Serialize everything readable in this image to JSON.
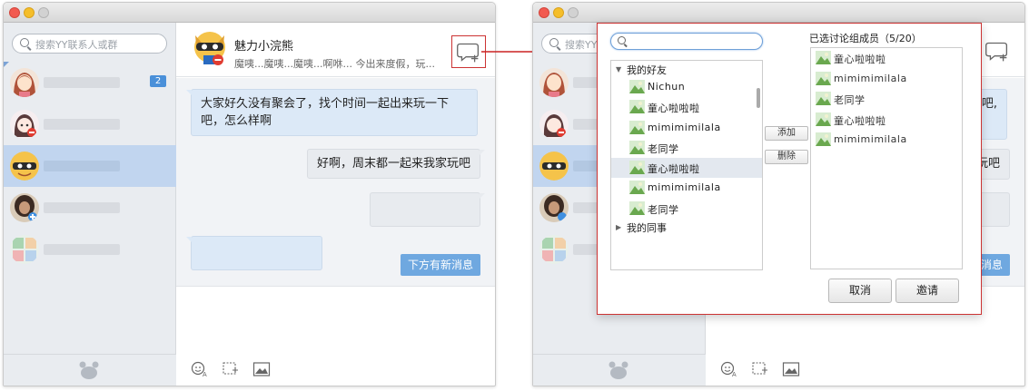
{
  "left_window": {
    "search_placeholder": "搜索YY联系人或群",
    "contacts": [
      {
        "badge": "2"
      },
      {},
      {},
      {},
      {}
    ],
    "chat": {
      "name": "魅力小浣熊",
      "signature": "魔咦...魔咦...魔咦...啊咻... 今出来度假，玩...",
      "messages": [
        {
          "side": "left",
          "text": "大家好久没有聚会了，找个时间一起出来玩一下吧，怎么样啊"
        },
        {
          "side": "right",
          "text": "好啊，周末都一起来我家玩吧"
        }
      ],
      "new_message_label": "下方有新消息"
    }
  },
  "right_window": {
    "search_placeholder": "搜索YY",
    "partial_texts": [
      "吧,",
      "玩吧",
      "新消息"
    ]
  },
  "dialog": {
    "search_value": "",
    "groups": [
      {
        "label": "我的好友",
        "expanded": true,
        "friends": [
          "Nichun",
          "童心啦啦啦",
          "mimimimilala",
          "老同学",
          "童心啦啦啦",
          "mimimimilala",
          "老同学"
        ]
      },
      {
        "label": "我的同事",
        "expanded": false,
        "friends": []
      }
    ],
    "add_label": "添加",
    "remove_label": "删除",
    "selected_header": "已选讨论组成员（5/20）",
    "selected": [
      "童心啦啦啦",
      "mimimimilala",
      "老同学",
      "童心啦啦啦",
      "mimimimilala"
    ],
    "cancel_label": "取消",
    "invite_label": "邀请"
  },
  "colors": {
    "accent": "#4a90d9",
    "highlight_border": "#cc3333",
    "selected_row": "#c1d5ef",
    "bubble": "#dce9f7"
  }
}
